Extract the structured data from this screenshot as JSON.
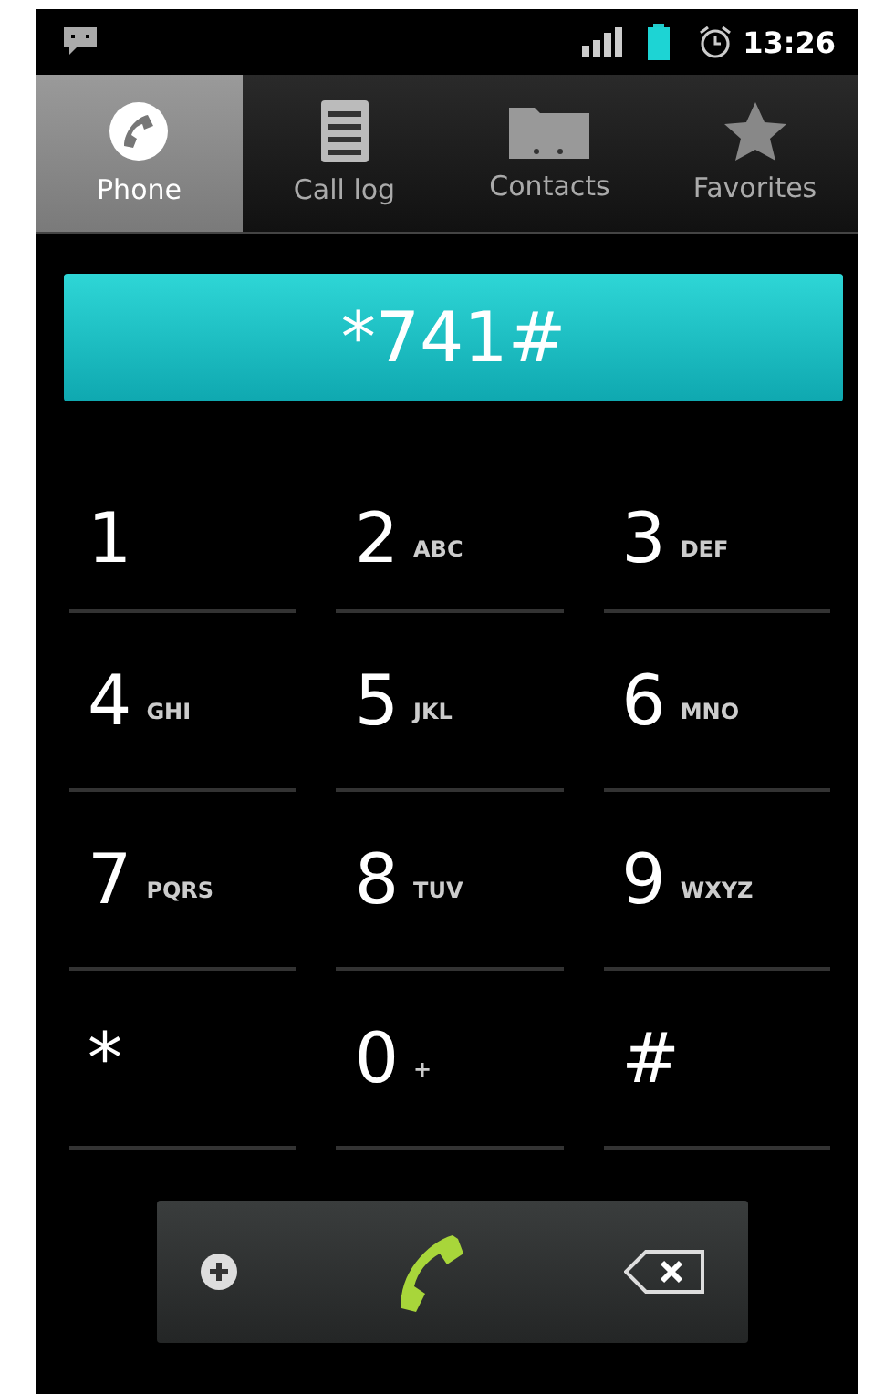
{
  "status_bar": {
    "time": "13:26"
  },
  "tabs": [
    {
      "label": "Phone",
      "selected": true
    },
    {
      "label": "Call log",
      "selected": false
    },
    {
      "label": "Contacts",
      "selected": false
    },
    {
      "label": "Favorites",
      "selected": false
    }
  ],
  "display": {
    "value": "*741#"
  },
  "keys": [
    {
      "digit": "1"
    },
    {
      "digit": "2",
      "letters": "ABC"
    },
    {
      "digit": "3",
      "letters": "DEF"
    },
    {
      "digit": "4",
      "letters": "GHI"
    },
    {
      "digit": "5",
      "letters": "JKL"
    },
    {
      "digit": "6",
      "letters": "MNO"
    },
    {
      "digit": "7",
      "letters": "PQRS"
    },
    {
      "digit": "8",
      "letters": "TUV"
    },
    {
      "digit": "9",
      "letters": "WXYZ"
    },
    {
      "digit": "*"
    },
    {
      "digit": "0",
      "letters": "+"
    },
    {
      "digit": "#"
    }
  ]
}
